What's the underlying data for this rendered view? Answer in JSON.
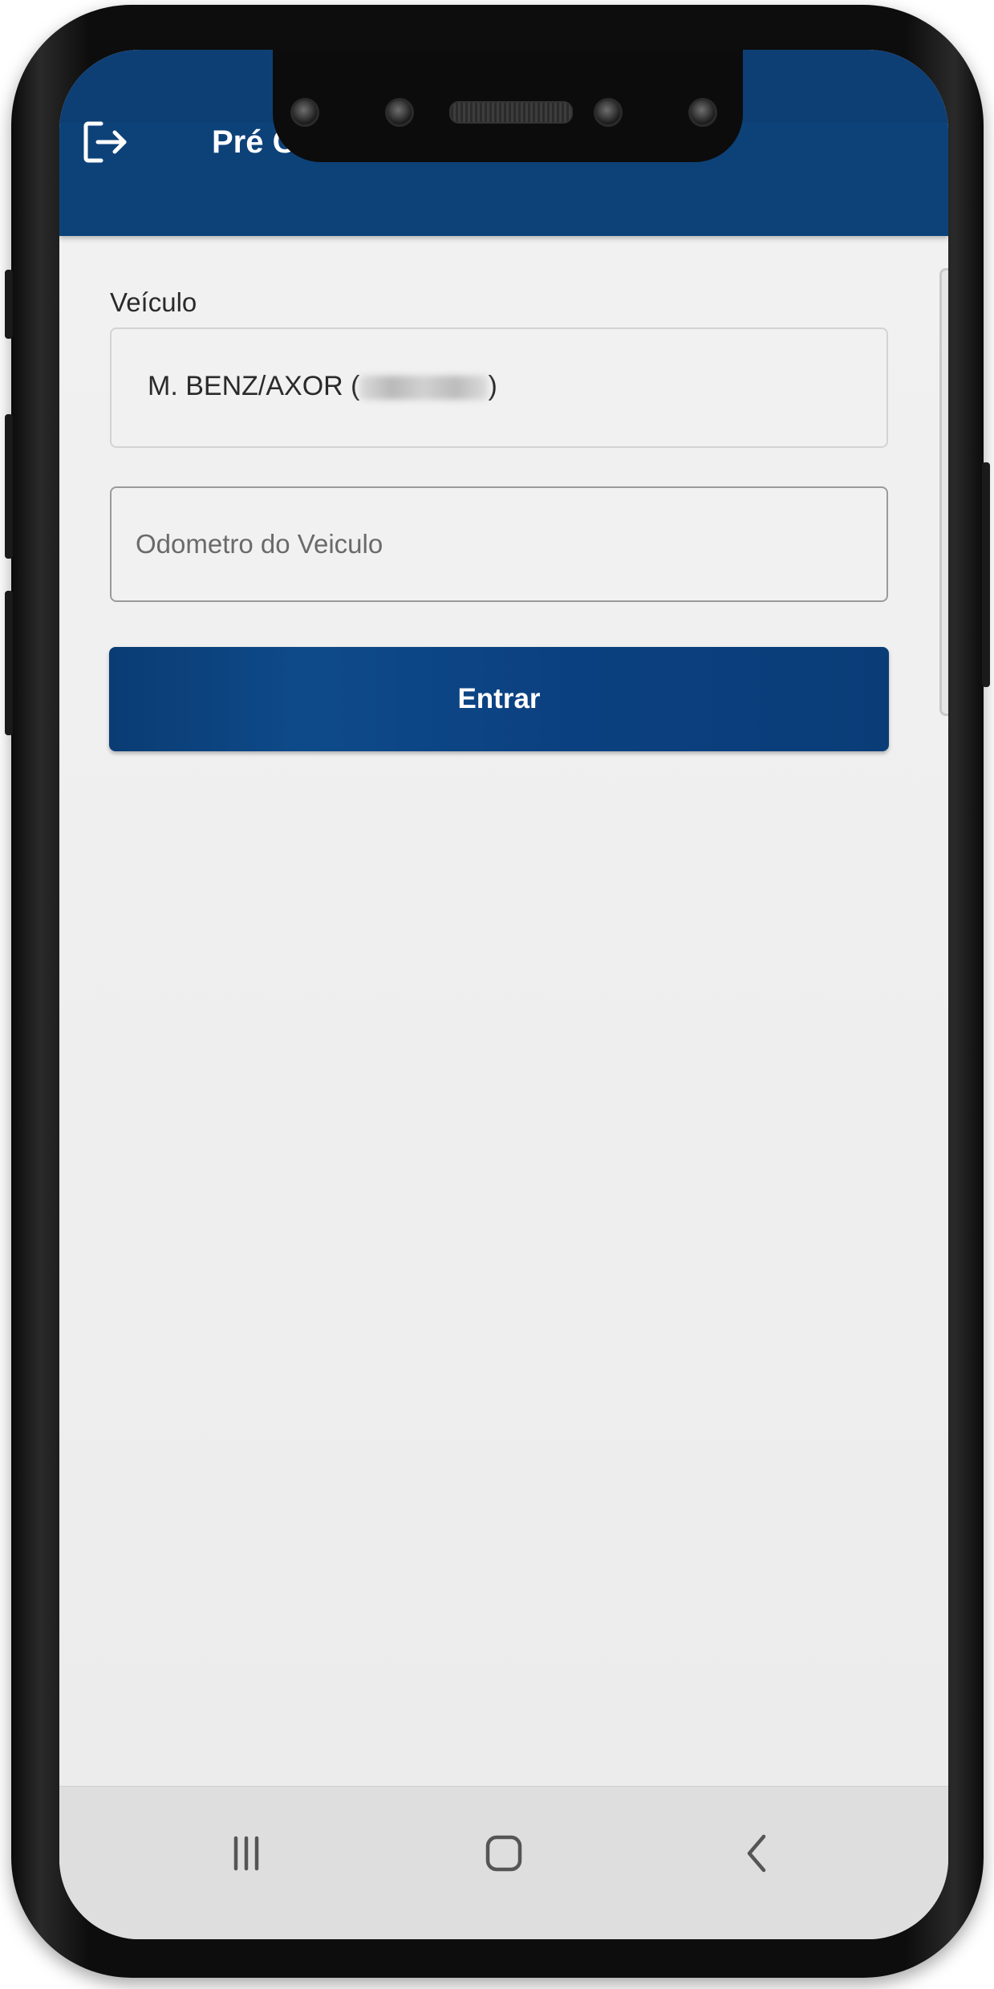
{
  "app_bar": {
    "title": "Pré Coleta",
    "logout_icon": "logout-icon"
  },
  "form": {
    "vehicle_label": "Veículo",
    "vehicle_value_prefix": "M. BENZ/AXOR (",
    "vehicle_value_suffix": ")",
    "odometer_placeholder": "Odometro do Veiculo",
    "odometer_value": "",
    "submit_label": "Entrar"
  },
  "nav_bar": {
    "recents_icon": "recents-icon",
    "home_icon": "home-icon",
    "back_icon": "back-icon"
  },
  "colors": {
    "primary": "#0d4279",
    "background": "#efefef",
    "nav_background": "#dedede"
  }
}
